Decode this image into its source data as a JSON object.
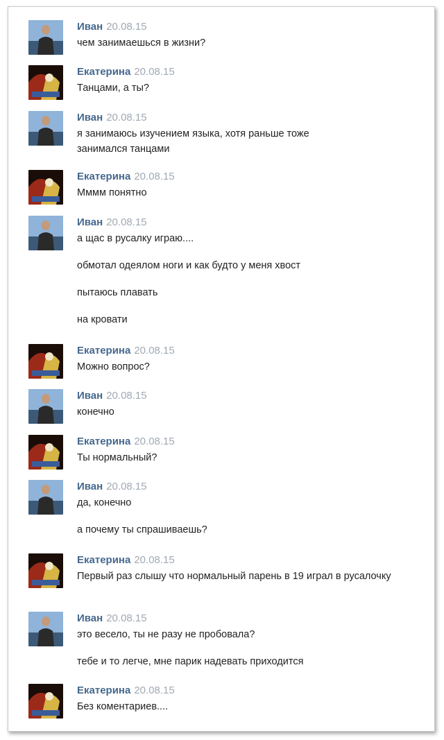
{
  "messages": [
    {
      "author": "Иван",
      "date": "20.08.15",
      "lines": [
        "чем занимаешься в жизни?"
      ]
    },
    {
      "author": "Екатерина",
      "date": "20.08.15",
      "lines": [
        "Танцами, а ты?"
      ]
    },
    {
      "author": "Иван",
      "date": "20.08.15",
      "lines": [
        "я занимаюсь изучением языка, хотя раньше тоже занимался танцами"
      ]
    },
    {
      "author": "Екатерина",
      "date": "20.08.15",
      "lines": [
        "Мммм понятно"
      ]
    },
    {
      "author": "Иван",
      "date": "20.08.15",
      "lines": [
        "а щас в русалку играю....",
        "обмотал одеялом ноги и как будто у меня хвост",
        "пытаюсь плавать",
        "на кровати"
      ]
    },
    {
      "author": "Екатерина",
      "date": "20.08.15",
      "lines": [
        "Можно вопрос?"
      ]
    },
    {
      "author": "Иван",
      "date": "20.08.15",
      "lines": [
        "конечно"
      ]
    },
    {
      "author": "Екатерина",
      "date": "20.08.15",
      "lines": [
        "Ты нормальный?"
      ]
    },
    {
      "author": "Иван",
      "date": "20.08.15",
      "lines": [
        "да, конечно",
        "а почему ты спрашиваешь?"
      ]
    },
    {
      "author": "Екатерина",
      "date": "20.08.15",
      "lines": [
        "Первый раз слышу что нормальный парень в 19 играл в русалочку"
      ]
    },
    {
      "author": "Иван",
      "date": "20.08.15",
      "lines": [
        "это весело, ты не разу не пробовала?",
        "тебе и то легче, мне парик надевать приходится"
      ]
    },
    {
      "author": "Екатерина",
      "date": "20.08.15",
      "lines": [
        "Без коментариев...."
      ]
    }
  ]
}
